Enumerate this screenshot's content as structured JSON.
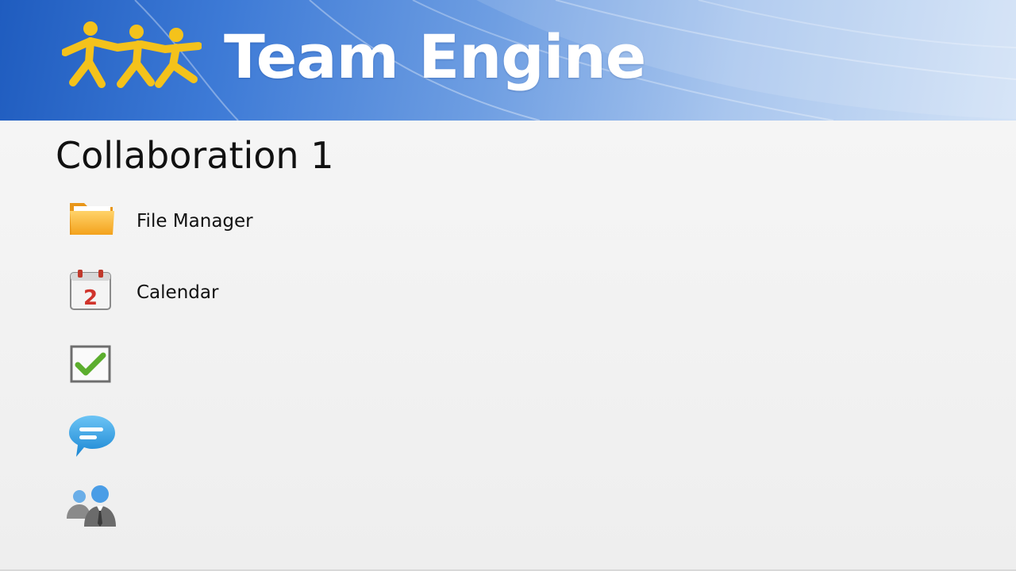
{
  "header": {
    "brand_title": "Team Engine",
    "logo_icon": "team-people-logo-icon",
    "accent_color": "#2f6cc9",
    "logo_color": "#f4c21b"
  },
  "main": {
    "title": "Collaboration 1",
    "menu": [
      {
        "icon": "folder-icon",
        "label": "File Manager"
      },
      {
        "icon": "calendar-icon",
        "label": "Calendar",
        "calendar_day": "2"
      },
      {
        "icon": "checkbox-icon",
        "label": ""
      },
      {
        "icon": "chat-bubble-icon",
        "label": ""
      },
      {
        "icon": "users-icon",
        "label": ""
      }
    ]
  }
}
